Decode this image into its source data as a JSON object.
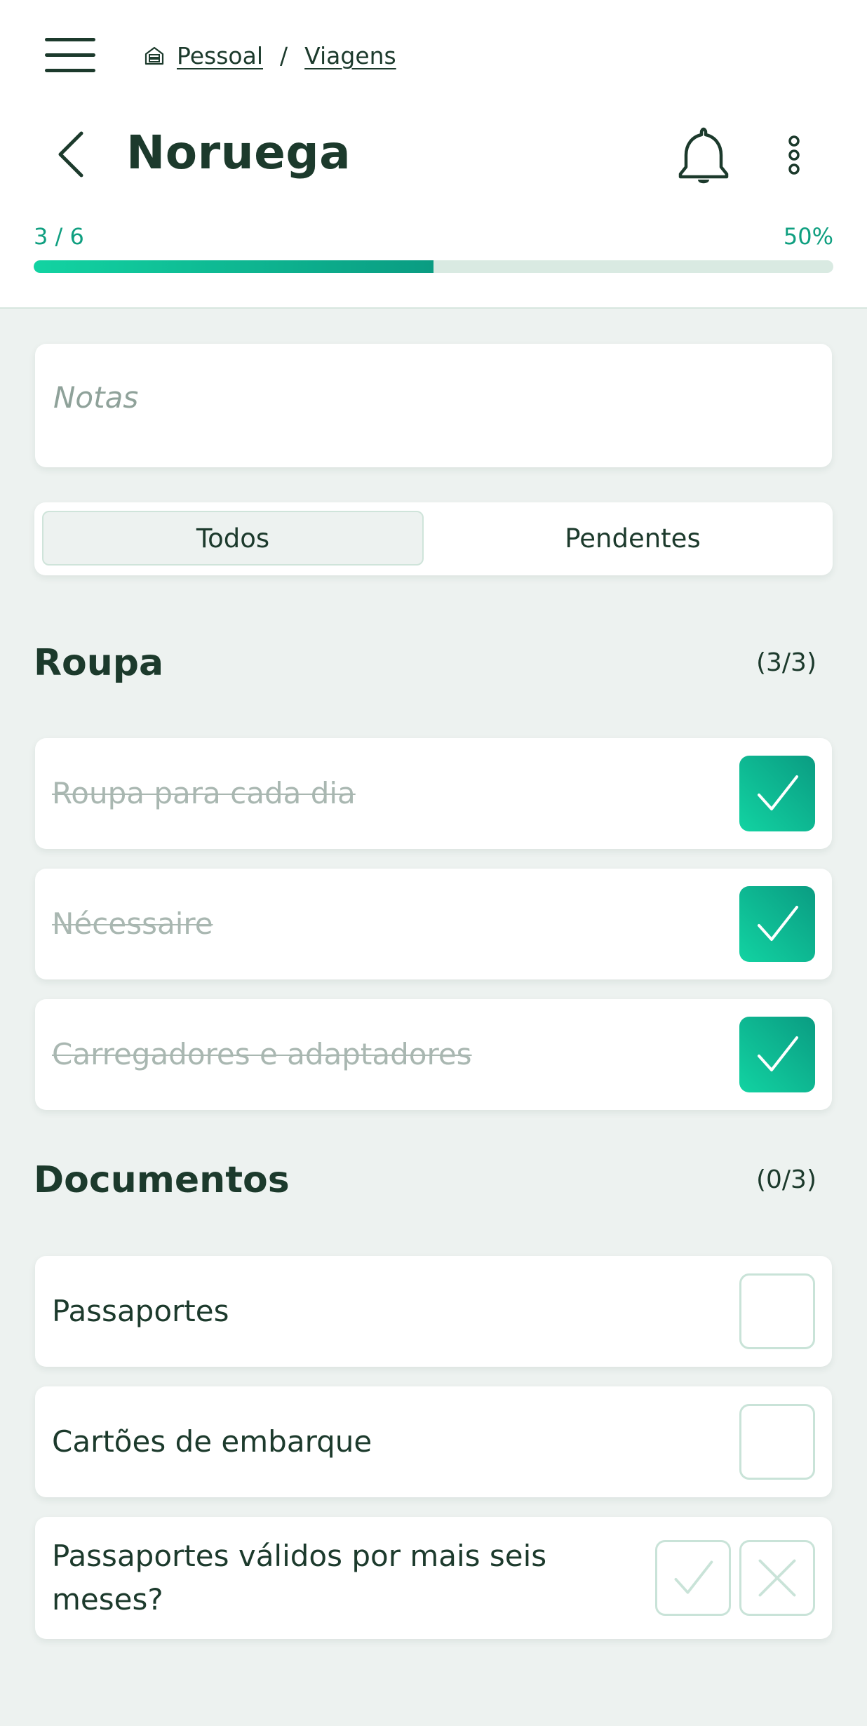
{
  "breadcrumb": {
    "items": [
      "Pessoal",
      "Viagens"
    ],
    "separator": "/"
  },
  "header": {
    "title": "Noruega",
    "progress_count": "3 / 6",
    "progress_percent": "50%",
    "progress_fraction": 0.5
  },
  "notes": {
    "placeholder": "Notas"
  },
  "filter_tabs": [
    {
      "label": "Todos",
      "active": true
    },
    {
      "label": "Pendentes",
      "active": false
    }
  ],
  "sections": [
    {
      "title": "Roupa",
      "count": "(3/3)",
      "items": [
        {
          "label": "Roupa para cada dia",
          "checked": true
        },
        {
          "label": "Nécessaire",
          "checked": true
        },
        {
          "label": "Carregadores e adaptadores",
          "checked": true
        }
      ]
    },
    {
      "title": "Documentos",
      "count": "(0/3)",
      "items": [
        {
          "label": "Passaportes",
          "checked": false
        },
        {
          "label": "Cartões de embarque",
          "checked": false
        },
        {
          "label": "Passaportes válidos por mais seis meses?",
          "type": "yes-no"
        }
      ]
    }
  ],
  "colors": {
    "accent": "#0f9f80",
    "accent_light": "#12d3a2",
    "text": "#1c3a2c",
    "background": "#edf2f0",
    "border": "#c9e3d8"
  },
  "icons": {
    "menu": "hamburger-menu-icon",
    "home": "house-icon",
    "back": "chevron-left-icon",
    "bell": "bell-icon",
    "more": "vertical-dots-icon",
    "check": "check-icon",
    "cross": "x-icon"
  }
}
